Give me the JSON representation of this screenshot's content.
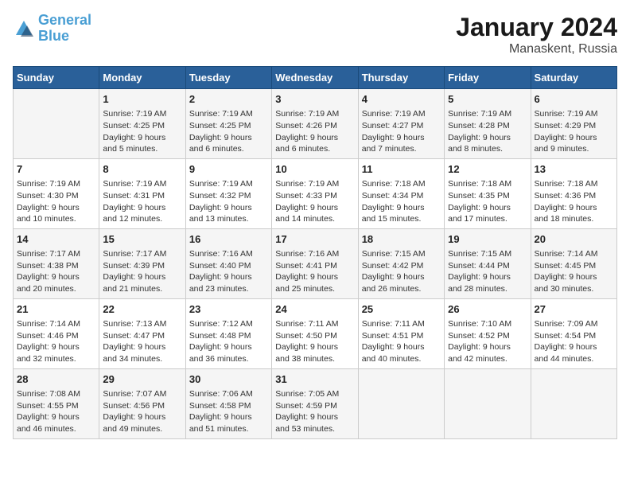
{
  "header": {
    "logo_line1": "General",
    "logo_line2": "Blue",
    "month": "January 2024",
    "location": "Manaskent, Russia"
  },
  "days_of_week": [
    "Sunday",
    "Monday",
    "Tuesday",
    "Wednesday",
    "Thursday",
    "Friday",
    "Saturday"
  ],
  "weeks": [
    [
      {
        "day": "",
        "info": ""
      },
      {
        "day": "1",
        "info": "Sunrise: 7:19 AM\nSunset: 4:25 PM\nDaylight: 9 hours\nand 5 minutes."
      },
      {
        "day": "2",
        "info": "Sunrise: 7:19 AM\nSunset: 4:25 PM\nDaylight: 9 hours\nand 6 minutes."
      },
      {
        "day": "3",
        "info": "Sunrise: 7:19 AM\nSunset: 4:26 PM\nDaylight: 9 hours\nand 6 minutes."
      },
      {
        "day": "4",
        "info": "Sunrise: 7:19 AM\nSunset: 4:27 PM\nDaylight: 9 hours\nand 7 minutes."
      },
      {
        "day": "5",
        "info": "Sunrise: 7:19 AM\nSunset: 4:28 PM\nDaylight: 9 hours\nand 8 minutes."
      },
      {
        "day": "6",
        "info": "Sunrise: 7:19 AM\nSunset: 4:29 PM\nDaylight: 9 hours\nand 9 minutes."
      }
    ],
    [
      {
        "day": "7",
        "info": "Sunrise: 7:19 AM\nSunset: 4:30 PM\nDaylight: 9 hours\nand 10 minutes."
      },
      {
        "day": "8",
        "info": "Sunrise: 7:19 AM\nSunset: 4:31 PM\nDaylight: 9 hours\nand 12 minutes."
      },
      {
        "day": "9",
        "info": "Sunrise: 7:19 AM\nSunset: 4:32 PM\nDaylight: 9 hours\nand 13 minutes."
      },
      {
        "day": "10",
        "info": "Sunrise: 7:19 AM\nSunset: 4:33 PM\nDaylight: 9 hours\nand 14 minutes."
      },
      {
        "day": "11",
        "info": "Sunrise: 7:18 AM\nSunset: 4:34 PM\nDaylight: 9 hours\nand 15 minutes."
      },
      {
        "day": "12",
        "info": "Sunrise: 7:18 AM\nSunset: 4:35 PM\nDaylight: 9 hours\nand 17 minutes."
      },
      {
        "day": "13",
        "info": "Sunrise: 7:18 AM\nSunset: 4:36 PM\nDaylight: 9 hours\nand 18 minutes."
      }
    ],
    [
      {
        "day": "14",
        "info": "Sunrise: 7:17 AM\nSunset: 4:38 PM\nDaylight: 9 hours\nand 20 minutes."
      },
      {
        "day": "15",
        "info": "Sunrise: 7:17 AM\nSunset: 4:39 PM\nDaylight: 9 hours\nand 21 minutes."
      },
      {
        "day": "16",
        "info": "Sunrise: 7:16 AM\nSunset: 4:40 PM\nDaylight: 9 hours\nand 23 minutes."
      },
      {
        "day": "17",
        "info": "Sunrise: 7:16 AM\nSunset: 4:41 PM\nDaylight: 9 hours\nand 25 minutes."
      },
      {
        "day": "18",
        "info": "Sunrise: 7:15 AM\nSunset: 4:42 PM\nDaylight: 9 hours\nand 26 minutes."
      },
      {
        "day": "19",
        "info": "Sunrise: 7:15 AM\nSunset: 4:44 PM\nDaylight: 9 hours\nand 28 minutes."
      },
      {
        "day": "20",
        "info": "Sunrise: 7:14 AM\nSunset: 4:45 PM\nDaylight: 9 hours\nand 30 minutes."
      }
    ],
    [
      {
        "day": "21",
        "info": "Sunrise: 7:14 AM\nSunset: 4:46 PM\nDaylight: 9 hours\nand 32 minutes."
      },
      {
        "day": "22",
        "info": "Sunrise: 7:13 AM\nSunset: 4:47 PM\nDaylight: 9 hours\nand 34 minutes."
      },
      {
        "day": "23",
        "info": "Sunrise: 7:12 AM\nSunset: 4:48 PM\nDaylight: 9 hours\nand 36 minutes."
      },
      {
        "day": "24",
        "info": "Sunrise: 7:11 AM\nSunset: 4:50 PM\nDaylight: 9 hours\nand 38 minutes."
      },
      {
        "day": "25",
        "info": "Sunrise: 7:11 AM\nSunset: 4:51 PM\nDaylight: 9 hours\nand 40 minutes."
      },
      {
        "day": "26",
        "info": "Sunrise: 7:10 AM\nSunset: 4:52 PM\nDaylight: 9 hours\nand 42 minutes."
      },
      {
        "day": "27",
        "info": "Sunrise: 7:09 AM\nSunset: 4:54 PM\nDaylight: 9 hours\nand 44 minutes."
      }
    ],
    [
      {
        "day": "28",
        "info": "Sunrise: 7:08 AM\nSunset: 4:55 PM\nDaylight: 9 hours\nand 46 minutes."
      },
      {
        "day": "29",
        "info": "Sunrise: 7:07 AM\nSunset: 4:56 PM\nDaylight: 9 hours\nand 49 minutes."
      },
      {
        "day": "30",
        "info": "Sunrise: 7:06 AM\nSunset: 4:58 PM\nDaylight: 9 hours\nand 51 minutes."
      },
      {
        "day": "31",
        "info": "Sunrise: 7:05 AM\nSunset: 4:59 PM\nDaylight: 9 hours\nand 53 minutes."
      },
      {
        "day": "",
        "info": ""
      },
      {
        "day": "",
        "info": ""
      },
      {
        "day": "",
        "info": ""
      }
    ]
  ]
}
